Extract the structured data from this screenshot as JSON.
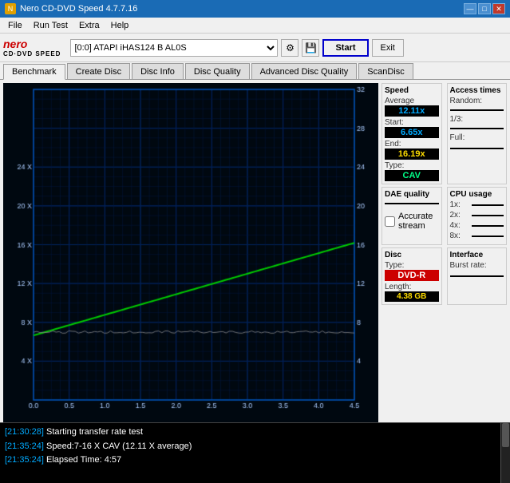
{
  "titlebar": {
    "title": "Nero CD-DVD Speed 4.7.7.16",
    "min_btn": "—",
    "max_btn": "□",
    "close_btn": "✕"
  },
  "menubar": {
    "items": [
      "File",
      "Run Test",
      "Extra",
      "Help"
    ]
  },
  "toolbar": {
    "logo_nero": "nero",
    "logo_sub": "CD·DVD SPEED",
    "drive_label": "[0:0]  ATAPI iHAS124  B AL0S",
    "start_label": "Start",
    "exit_label": "Exit"
  },
  "tabs": {
    "items": [
      "Benchmark",
      "Create Disc",
      "Disc Info",
      "Disc Quality",
      "Advanced Disc Quality",
      "ScanDisc"
    ],
    "active": 0
  },
  "speed_panel": {
    "title": "Speed",
    "average_label": "Average",
    "average_value": "12.11x",
    "start_label": "Start:",
    "start_value": "6.65x",
    "end_label": "End:",
    "end_value": "16.19x",
    "type_label": "Type:",
    "type_value": "CAV"
  },
  "access_panel": {
    "title": "Access times",
    "random_label": "Random:",
    "onethird_label": "1/3:",
    "full_label": "Full:"
  },
  "cpu_panel": {
    "title": "CPU usage",
    "1x_label": "1x:",
    "2x_label": "2x:",
    "4x_label": "4x:",
    "8x_label": "8x:"
  },
  "dae_panel": {
    "title": "DAE quality",
    "accurate_label": "Accurate",
    "stream_label": "stream"
  },
  "disc_panel": {
    "title": "Disc",
    "type_label": "Type:",
    "type_value": "DVD-R",
    "length_label": "Length:",
    "length_value": "4.38 GB"
  },
  "interface_panel": {
    "title": "Interface",
    "burst_label": "Burst rate:"
  },
  "chart": {
    "y_left": [
      "24 X",
      "20 X",
      "16 X",
      "12 X",
      "8 X",
      "4 X"
    ],
    "y_right": [
      "32",
      "28",
      "24",
      "20",
      "16",
      "12",
      "8",
      "4"
    ],
    "x_axis": [
      "0.0",
      "0.5",
      "1.0",
      "1.5",
      "2.0",
      "2.5",
      "3.0",
      "3.5",
      "4.0",
      "4.5"
    ]
  },
  "log": {
    "lines": [
      {
        "timestamp": "[21:30:28]",
        "text": " Starting transfer rate test"
      },
      {
        "timestamp": "[21:35:24]",
        "text": " Speed:7-16 X CAV (12.11 X average)"
      },
      {
        "timestamp": "[21:35:24]",
        "text": " Elapsed Time: 4:57"
      }
    ]
  }
}
